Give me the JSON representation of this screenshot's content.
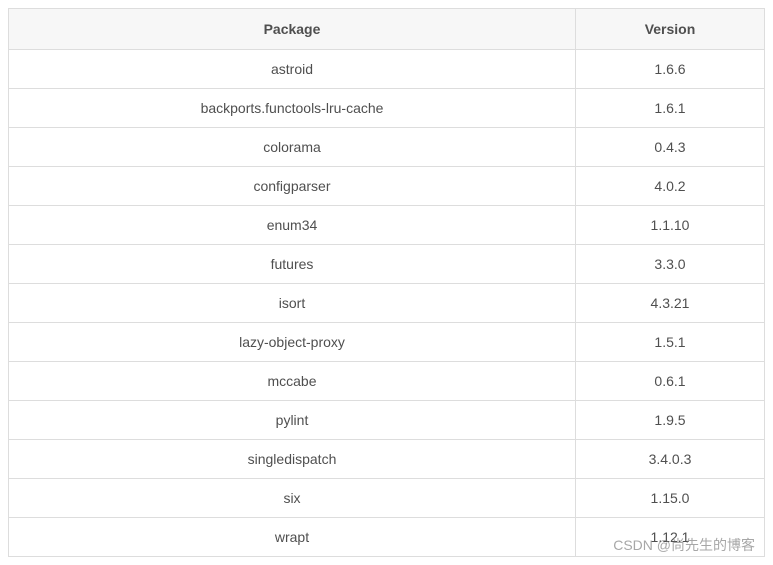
{
  "table": {
    "headers": {
      "package": "Package",
      "version": "Version"
    },
    "rows": [
      {
        "package": "astroid",
        "version": "1.6.6"
      },
      {
        "package": "backports.functools-lru-cache",
        "version": "1.6.1"
      },
      {
        "package": "colorama",
        "version": "0.4.3"
      },
      {
        "package": "configparser",
        "version": "4.0.2"
      },
      {
        "package": "enum34",
        "version": "1.1.10"
      },
      {
        "package": "futures",
        "version": "3.3.0"
      },
      {
        "package": "isort",
        "version": "4.3.21"
      },
      {
        "package": "lazy-object-proxy",
        "version": "1.5.1"
      },
      {
        "package": "mccabe",
        "version": "0.6.1"
      },
      {
        "package": "pylint",
        "version": "1.9.5"
      },
      {
        "package": "singledispatch",
        "version": "3.4.0.3"
      },
      {
        "package": "six",
        "version": "1.15.0"
      },
      {
        "package": "wrapt",
        "version": "1.12.1"
      }
    ]
  },
  "watermark": "CSDN @尚先生的博客"
}
